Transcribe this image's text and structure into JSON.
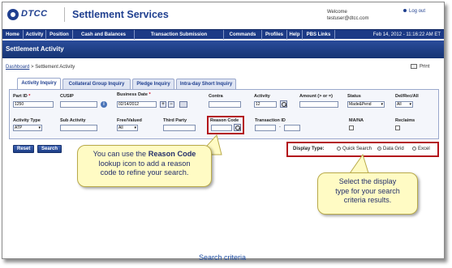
{
  "header": {
    "logo_text": "DTCC",
    "app_title": "Settlement Services",
    "welcome_label": "Welcome",
    "user_email": "testuser@dtcc.com",
    "logout_label": "Log out"
  },
  "nav": {
    "items": [
      "Home",
      "Activity",
      "Position",
      "Cash and Balances",
      "Transaction Submission",
      "Commands",
      "Profiles",
      "Help",
      "PBS Links"
    ],
    "datetime": "Feb 14, 2012 - 11:16:22 AM ET"
  },
  "page": {
    "title": "Settlement Activity",
    "breadcrumb_link": "Dashboard",
    "breadcrumb_sep": ">",
    "breadcrumb_current": "Settlement Activity",
    "print_label": "Print"
  },
  "tabs": [
    "Activity Inquiry",
    "Collateral Group Inquiry",
    "Pledge Inquiry",
    "Intra-day Short Inquiry"
  ],
  "form": {
    "part_id": {
      "label": "Part ID",
      "value": "1250"
    },
    "cusip": {
      "label": "CUSIP",
      "value": ""
    },
    "business_date": {
      "label": "Business Date",
      "value": "02/14/2012",
      "plus": "+",
      "minus": "−"
    },
    "contra": {
      "label": "Contra",
      "value": ""
    },
    "activity": {
      "label": "Activity",
      "value": "12"
    },
    "amount": {
      "label": "Amount (> or =)",
      "value": ""
    },
    "status": {
      "label": "Status",
      "value": "Made&Pend"
    },
    "del_rec_all": {
      "label": "Del/Rec/All",
      "value": "All"
    },
    "activity_type": {
      "label": "Activity Type",
      "value": "ATP"
    },
    "sub_activity": {
      "label": "Sub Activity",
      "value": ""
    },
    "free_valued": {
      "label": "Free/Valued",
      "value": "All"
    },
    "third_party": {
      "label": "Third Party",
      "value": ""
    },
    "reason_code": {
      "label": "Reason Code",
      "value": ""
    },
    "transaction_id": {
      "label": "Transaction ID",
      "value": "",
      "sep": "-"
    },
    "ma_na": {
      "label": "MA/NA"
    },
    "reclaims": {
      "label": "Reclaims"
    },
    "required_mark": "*"
  },
  "buttons": {
    "reset": "Reset",
    "search": "Search"
  },
  "display_type": {
    "label": "Display Type:",
    "options": [
      "Quick Search",
      "Data Grid",
      "Excel"
    ],
    "selected": "Data Grid"
  },
  "callouts": {
    "reason_line1_pre": "You can use the ",
    "reason_line1_bold": "Reason Code",
    "reason_line2": "lookup icon to add a reason",
    "reason_line3": "code to refine your search.",
    "display_line1": "Select the display",
    "display_line2": "type for your search",
    "display_line3": "criteria results."
  },
  "caption": "Search criteria",
  "colors": {
    "nav": "#1c3a86",
    "highlight": "#b3121b",
    "callout": "#fffbc4",
    "brand": "#1f3f8f"
  }
}
